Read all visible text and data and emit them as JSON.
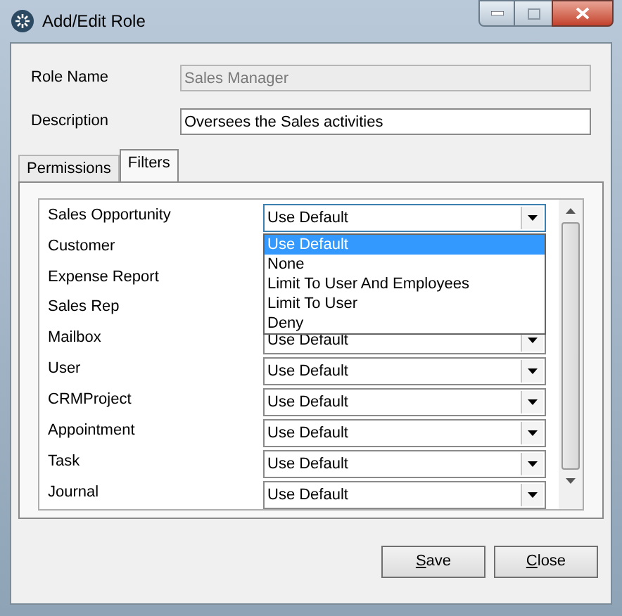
{
  "window": {
    "title": "Add/Edit Role"
  },
  "role_name": {
    "label": "Role Name",
    "value": "Sales Manager",
    "disabled": true
  },
  "description": {
    "label": "Description",
    "value": "Oversees the Sales activities"
  },
  "tabs": [
    {
      "label": "Permissions",
      "selected": false
    },
    {
      "label": "Filters",
      "selected": true
    }
  ],
  "filters": [
    {
      "label": "Sales Opportunity",
      "value": "Use Default",
      "expanded": true
    },
    {
      "label": "Customer"
    },
    {
      "label": "Expense Report"
    },
    {
      "label": "Sales Rep"
    },
    {
      "label": "Mailbox",
      "value": "Use Default",
      "expanded": false
    },
    {
      "label": "User",
      "value": "Use Default",
      "expanded": false
    },
    {
      "label": "CRMProject",
      "value": "Use Default",
      "expanded": false
    },
    {
      "label": "Appointment",
      "value": "Use Default",
      "expanded": false
    },
    {
      "label": "Task",
      "value": "Use Default",
      "expanded": false
    },
    {
      "label": "Journal",
      "value": "Use Default",
      "expanded": false
    }
  ],
  "dropdown_options": [
    {
      "label": "Use Default",
      "selected": true
    },
    {
      "label": "None",
      "selected": false
    },
    {
      "label": "Limit To User And Employees",
      "selected": false
    },
    {
      "label": "Limit To User",
      "selected": false
    },
    {
      "label": "Deny",
      "selected": false
    }
  ],
  "buttons": [
    {
      "mnemonic": "S",
      "rest": "ave"
    },
    {
      "mnemonic": "C",
      "rest": "lose"
    }
  ]
}
